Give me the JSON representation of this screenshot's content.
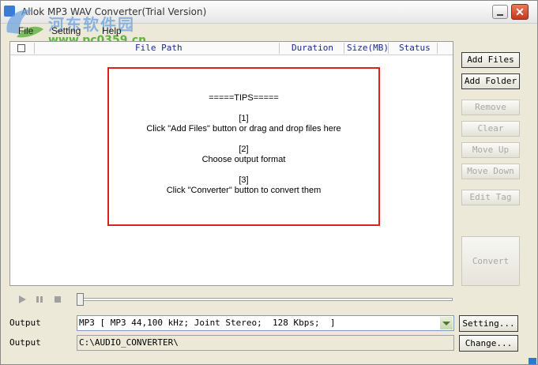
{
  "window": {
    "title": "Allok MP3 WAV Converter(Trial Version)",
    "close_glyph": "✕"
  },
  "watermark": {
    "line1": "河东软件园",
    "line2": "www.pc0359.cn"
  },
  "menu": [
    {
      "label": "File"
    },
    {
      "label": "Setting"
    },
    {
      "label": "Help"
    }
  ],
  "file_list": {
    "columns": [
      "File Path",
      "Duration",
      "Size(MB)",
      "Status"
    ]
  },
  "tips": {
    "heading": "=====TIPS=====",
    "steps": [
      {
        "num": "[1]",
        "text": "Click \"Add Files\" button or drag and drop files here"
      },
      {
        "num": "[2]",
        "text": "Choose output format"
      },
      {
        "num": "[3]",
        "text": "Click \"Converter\" button to convert them"
      }
    ]
  },
  "side_buttons": [
    {
      "label": "Add Files",
      "enabled": true
    },
    {
      "label": "Add Folder",
      "enabled": true
    },
    {
      "label": "Remove",
      "enabled": false
    },
    {
      "label": "Clear",
      "enabled": false
    },
    {
      "label": "Move Up",
      "enabled": false
    },
    {
      "label": "Move Down",
      "enabled": false
    },
    {
      "label": "Edit Tag",
      "enabled": false
    }
  ],
  "convert_button": {
    "label": "Convert",
    "enabled": false
  },
  "output": {
    "label": "Output",
    "format_value": "MP3 [ MP3 44,100 kHz; Joint Stereo;  128 Kbps;  ]",
    "setting_button": "Setting...",
    "path_label": "Output",
    "path_value": "C:\\AUDIO_CONVERTER\\",
    "change_button": "Change..."
  },
  "player": {
    "play_icon": "play-icon",
    "pause_icon": "pause-icon",
    "stop_icon": "stop-icon"
  },
  "seek": {
    "position": 0
  },
  "colors": {
    "tips_border": "#e02020",
    "header_text": "#1a2a8a",
    "watermark_blue": "#6aa0e0",
    "watermark_green": "#4aa82a"
  }
}
